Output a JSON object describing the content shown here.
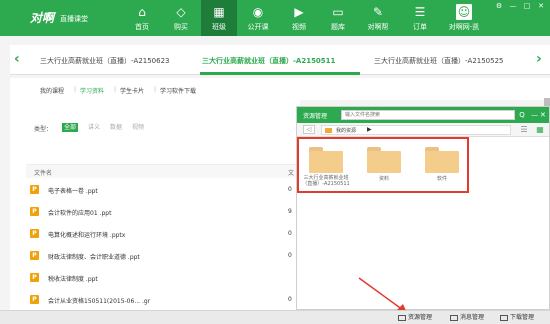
{
  "app": {
    "logo": "对啊",
    "logo_sub": "直播课堂"
  },
  "nav": [
    {
      "label": "首页",
      "icon": "home-icon"
    },
    {
      "label": "购买",
      "icon": "diamond-icon"
    },
    {
      "label": "班级",
      "icon": "class-icon",
      "active": true
    },
    {
      "label": "公开课",
      "icon": "play-circle-icon"
    },
    {
      "label": "视频",
      "icon": "video-icon"
    },
    {
      "label": "题库",
      "icon": "folder-icon"
    },
    {
      "label": "对啊帮",
      "icon": "help-icon"
    },
    {
      "label": "订单",
      "icon": "order-icon"
    },
    {
      "label": "对啊网-凯",
      "icon": "avatar-icon"
    }
  ],
  "window": {
    "settings": "⚙",
    "minimize": "—",
    "maximize": "□",
    "close": "✕"
  },
  "courses": [
    {
      "label": "三大行业高薪就业班（直播）-A2150623"
    },
    {
      "label": "三大行业高薪就业班（直播）-A2150511",
      "active": true
    },
    {
      "label": "三大行业高薪就业班（直播）-A2150525"
    }
  ],
  "subtabs": [
    "我的课程",
    "学习资料",
    "学生卡片",
    "学习软件下载"
  ],
  "subtab_sep": "|",
  "filter": {
    "label": "类型：",
    "types": [
      "全部",
      "讲义",
      "数据",
      "视频"
    ]
  },
  "files": {
    "header": "文件名",
    "header_right": "文",
    "items": [
      {
        "name": "电子表格一卷  .ppt",
        "right": "0"
      },
      {
        "name": "会计软件的应用01  .ppt",
        "right": "9"
      },
      {
        "name": "电算化概述和运行环境  .pptx",
        "right": "0"
      },
      {
        "name": "财政法律制度、会计职业道德  .ppt",
        "right": "0"
      },
      {
        "name": "税收法律制度  .ppt",
        "right": ""
      },
      {
        "name": "会计从业资格150511(2015-06...  .gr",
        "right": "0"
      }
    ]
  },
  "resource_panel": {
    "title": "资源管理",
    "search_placeholder": "输入文件名搜索",
    "search_btn": "Q",
    "ctl_min": "—",
    "ctl_close": "✕",
    "back": "◁",
    "breadcrumb": "我的资源",
    "breadcrumb_arrow": "▶",
    "folders": [
      "三大行业高薪就业班（直播）-A2150511",
      "资料",
      "软件"
    ]
  },
  "statusbar": {
    "items": [
      "资源管理",
      "消息管理",
      "下载管理"
    ]
  },
  "colors": {
    "brand": "#2daa4f",
    "highlight": "#e23b2e",
    "folder": "#f4cd8d"
  }
}
